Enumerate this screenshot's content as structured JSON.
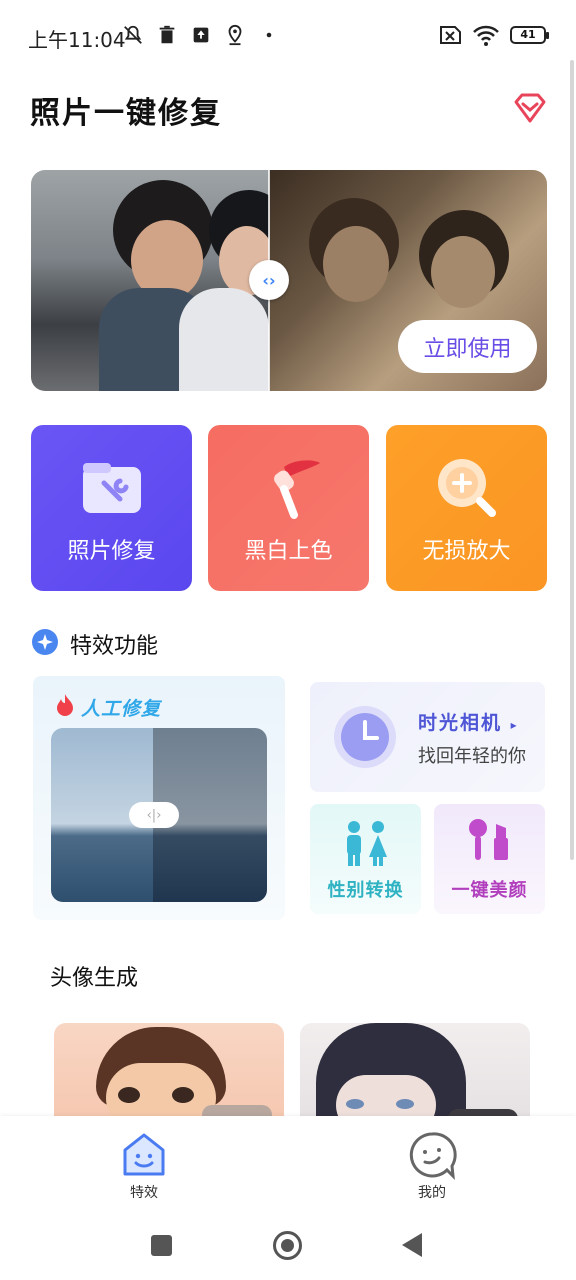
{
  "status_bar": {
    "time": "上午11:04",
    "battery": "41",
    "icons": [
      "mute-icon",
      "trash-icon",
      "upload-icon",
      "location-icon",
      "dot-icon",
      "sim-icon",
      "wifi-icon",
      "battery-icon"
    ]
  },
  "header": {
    "title": "照片一键修复",
    "vip_icon": "diamond-icon"
  },
  "hero": {
    "button_label": "立即使用",
    "handle_symbol": "‹›"
  },
  "tiles": [
    {
      "label": "照片修复",
      "icon": "repair-folder-icon",
      "color": "#5b48ef"
    },
    {
      "label": "黑白上色",
      "icon": "paintbrush-icon",
      "color": "#f5706a"
    },
    {
      "label": "无损放大",
      "icon": "magnifier-plus-icon",
      "color": "#fc9a27"
    }
  ],
  "effects_section": {
    "title": "特效功能",
    "manual_repair": {
      "label": "人工修复",
      "handle_symbol": "‹|›"
    },
    "time_camera": {
      "title": "时光相机",
      "arrow": "▸",
      "subtitle": "找回年轻的你"
    },
    "gender_swap": {
      "label": "性别转换"
    },
    "beauty": {
      "label": "一键美颜"
    }
  },
  "avatar_section": {
    "title": "头像生成"
  },
  "bottom_nav": {
    "items": [
      {
        "label": "特效",
        "icon": "home-smile-icon",
        "active": true
      },
      {
        "label": "我的",
        "icon": "profile-smile-icon",
        "active": false
      }
    ]
  },
  "colors": {
    "accent": "#5b48ef",
    "red": "#f5706a",
    "orange": "#fc9a27",
    "nav_active": "#4a7bf0"
  }
}
